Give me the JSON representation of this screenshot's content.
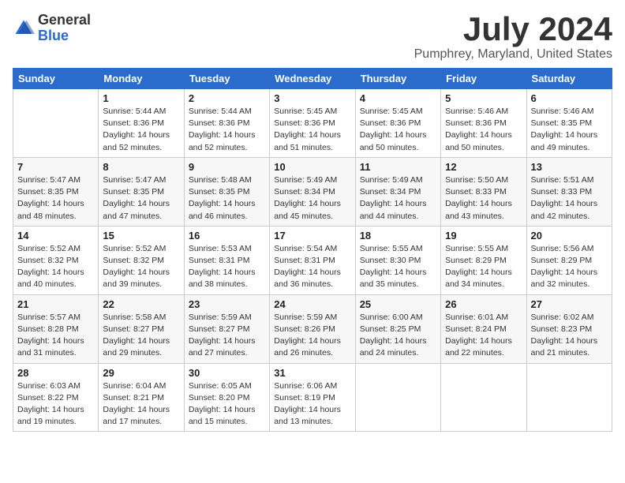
{
  "logo": {
    "general": "General",
    "blue": "Blue"
  },
  "title": "July 2024",
  "subtitle": "Pumphrey, Maryland, United States",
  "weekdays": [
    "Sunday",
    "Monday",
    "Tuesday",
    "Wednesday",
    "Thursday",
    "Friday",
    "Saturday"
  ],
  "weeks": [
    [
      {
        "day": "",
        "info": ""
      },
      {
        "day": "1",
        "info": "Sunrise: 5:44 AM\nSunset: 8:36 PM\nDaylight: 14 hours\nand 52 minutes."
      },
      {
        "day": "2",
        "info": "Sunrise: 5:44 AM\nSunset: 8:36 PM\nDaylight: 14 hours\nand 52 minutes."
      },
      {
        "day": "3",
        "info": "Sunrise: 5:45 AM\nSunset: 8:36 PM\nDaylight: 14 hours\nand 51 minutes."
      },
      {
        "day": "4",
        "info": "Sunrise: 5:45 AM\nSunset: 8:36 PM\nDaylight: 14 hours\nand 50 minutes."
      },
      {
        "day": "5",
        "info": "Sunrise: 5:46 AM\nSunset: 8:36 PM\nDaylight: 14 hours\nand 50 minutes."
      },
      {
        "day": "6",
        "info": "Sunrise: 5:46 AM\nSunset: 8:35 PM\nDaylight: 14 hours\nand 49 minutes."
      }
    ],
    [
      {
        "day": "7",
        "info": "Sunrise: 5:47 AM\nSunset: 8:35 PM\nDaylight: 14 hours\nand 48 minutes."
      },
      {
        "day": "8",
        "info": "Sunrise: 5:47 AM\nSunset: 8:35 PM\nDaylight: 14 hours\nand 47 minutes."
      },
      {
        "day": "9",
        "info": "Sunrise: 5:48 AM\nSunset: 8:35 PM\nDaylight: 14 hours\nand 46 minutes."
      },
      {
        "day": "10",
        "info": "Sunrise: 5:49 AM\nSunset: 8:34 PM\nDaylight: 14 hours\nand 45 minutes."
      },
      {
        "day": "11",
        "info": "Sunrise: 5:49 AM\nSunset: 8:34 PM\nDaylight: 14 hours\nand 44 minutes."
      },
      {
        "day": "12",
        "info": "Sunrise: 5:50 AM\nSunset: 8:33 PM\nDaylight: 14 hours\nand 43 minutes."
      },
      {
        "day": "13",
        "info": "Sunrise: 5:51 AM\nSunset: 8:33 PM\nDaylight: 14 hours\nand 42 minutes."
      }
    ],
    [
      {
        "day": "14",
        "info": "Sunrise: 5:52 AM\nSunset: 8:32 PM\nDaylight: 14 hours\nand 40 minutes."
      },
      {
        "day": "15",
        "info": "Sunrise: 5:52 AM\nSunset: 8:32 PM\nDaylight: 14 hours\nand 39 minutes."
      },
      {
        "day": "16",
        "info": "Sunrise: 5:53 AM\nSunset: 8:31 PM\nDaylight: 14 hours\nand 38 minutes."
      },
      {
        "day": "17",
        "info": "Sunrise: 5:54 AM\nSunset: 8:31 PM\nDaylight: 14 hours\nand 36 minutes."
      },
      {
        "day": "18",
        "info": "Sunrise: 5:55 AM\nSunset: 8:30 PM\nDaylight: 14 hours\nand 35 minutes."
      },
      {
        "day": "19",
        "info": "Sunrise: 5:55 AM\nSunset: 8:29 PM\nDaylight: 14 hours\nand 34 minutes."
      },
      {
        "day": "20",
        "info": "Sunrise: 5:56 AM\nSunset: 8:29 PM\nDaylight: 14 hours\nand 32 minutes."
      }
    ],
    [
      {
        "day": "21",
        "info": "Sunrise: 5:57 AM\nSunset: 8:28 PM\nDaylight: 14 hours\nand 31 minutes."
      },
      {
        "day": "22",
        "info": "Sunrise: 5:58 AM\nSunset: 8:27 PM\nDaylight: 14 hours\nand 29 minutes."
      },
      {
        "day": "23",
        "info": "Sunrise: 5:59 AM\nSunset: 8:27 PM\nDaylight: 14 hours\nand 27 minutes."
      },
      {
        "day": "24",
        "info": "Sunrise: 5:59 AM\nSunset: 8:26 PM\nDaylight: 14 hours\nand 26 minutes."
      },
      {
        "day": "25",
        "info": "Sunrise: 6:00 AM\nSunset: 8:25 PM\nDaylight: 14 hours\nand 24 minutes."
      },
      {
        "day": "26",
        "info": "Sunrise: 6:01 AM\nSunset: 8:24 PM\nDaylight: 14 hours\nand 22 minutes."
      },
      {
        "day": "27",
        "info": "Sunrise: 6:02 AM\nSunset: 8:23 PM\nDaylight: 14 hours\nand 21 minutes."
      }
    ],
    [
      {
        "day": "28",
        "info": "Sunrise: 6:03 AM\nSunset: 8:22 PM\nDaylight: 14 hours\nand 19 minutes."
      },
      {
        "day": "29",
        "info": "Sunrise: 6:04 AM\nSunset: 8:21 PM\nDaylight: 14 hours\nand 17 minutes."
      },
      {
        "day": "30",
        "info": "Sunrise: 6:05 AM\nSunset: 8:20 PM\nDaylight: 14 hours\nand 15 minutes."
      },
      {
        "day": "31",
        "info": "Sunrise: 6:06 AM\nSunset: 8:19 PM\nDaylight: 14 hours\nand 13 minutes."
      },
      {
        "day": "",
        "info": ""
      },
      {
        "day": "",
        "info": ""
      },
      {
        "day": "",
        "info": ""
      }
    ]
  ]
}
